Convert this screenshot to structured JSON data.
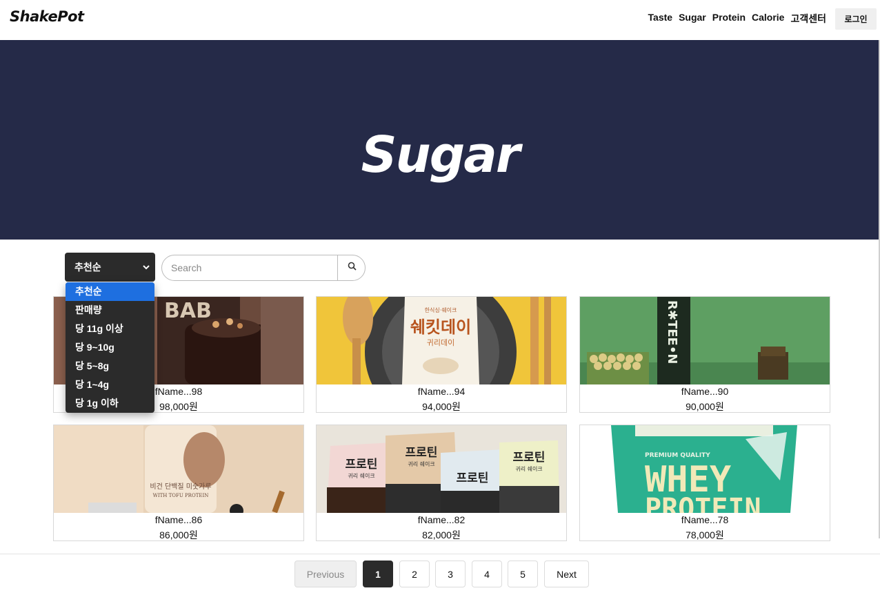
{
  "header": {
    "logo": "ShakePot",
    "nav": [
      "Taste",
      "Sugar",
      "Protein",
      "Calorie",
      "고객센터"
    ],
    "login_label": "로그인"
  },
  "hero": {
    "title": "Sugar"
  },
  "controls": {
    "sort_selected": "추천순",
    "search_placeholder": "Search"
  },
  "sort_options": [
    "추천순",
    "판매량",
    "당 11g 이상",
    "당 9~10g",
    "당 5~8g",
    "당 1~4g",
    "당 1g 이하"
  ],
  "products": [
    {
      "name": "fName...98",
      "price": "98,000원"
    },
    {
      "name": "fName...94",
      "price": "94,000원"
    },
    {
      "name": "fName...90",
      "price": "90,000원"
    },
    {
      "name": "fName...86",
      "price": "86,000원"
    },
    {
      "name": "fName...82",
      "price": "82,000원"
    },
    {
      "name": "fName...78",
      "price": "78,000원"
    }
  ],
  "product_image_text": {
    "p1": "BAB",
    "p2_top": "한식싱·쉐이크",
    "p2_title": "쉐킷데이",
    "p2_sub": "귀리데이",
    "p3": "R✱TEE•N",
    "p4_title": "비건 단백질 미숫가루",
    "p4_sub": "WITH TOFU PROTEIN",
    "p5_title": "프로틴",
    "p5_sub": "귀리 쉐이크",
    "p6_top": "PREMIUM QUALITY",
    "p6_title": "WHEY",
    "p6_sub": "PROTEIN"
  },
  "pagination": {
    "prev": "Previous",
    "pages": [
      "1",
      "2",
      "3",
      "4",
      "5"
    ],
    "active": "1",
    "next": "Next"
  },
  "colors": {
    "hero_bg": "#252a48",
    "dark": "#2b2b2b",
    "selected_option": "#1e6fe0"
  }
}
